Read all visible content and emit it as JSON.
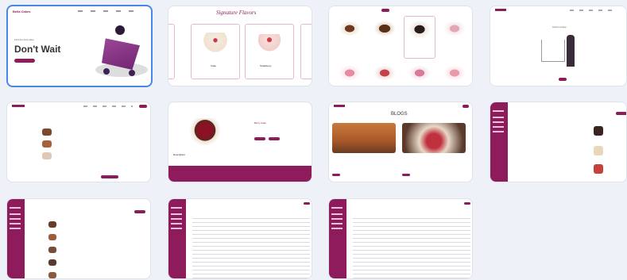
{
  "brand_color": "#8e1c5c",
  "thumbnails": [
    {
      "name": "home-hero",
      "text": "Don't Wait",
      "logo": "Bella Cakes"
    },
    {
      "name": "signature-flavors",
      "title": "Signature Flavors",
      "cards": [
        "Cake",
        "Strawberry"
      ]
    },
    {
      "name": "product-grid"
    },
    {
      "name": "empty-cart",
      "text": "Cart is empty"
    },
    {
      "name": "cart-list"
    },
    {
      "name": "product-detail",
      "label": "Description"
    },
    {
      "name": "blogs",
      "title": "BLOGS"
    },
    {
      "name": "admin-products"
    },
    {
      "name": "admin-orders"
    },
    {
      "name": "admin-customers"
    },
    {
      "name": "admin-users"
    }
  ]
}
